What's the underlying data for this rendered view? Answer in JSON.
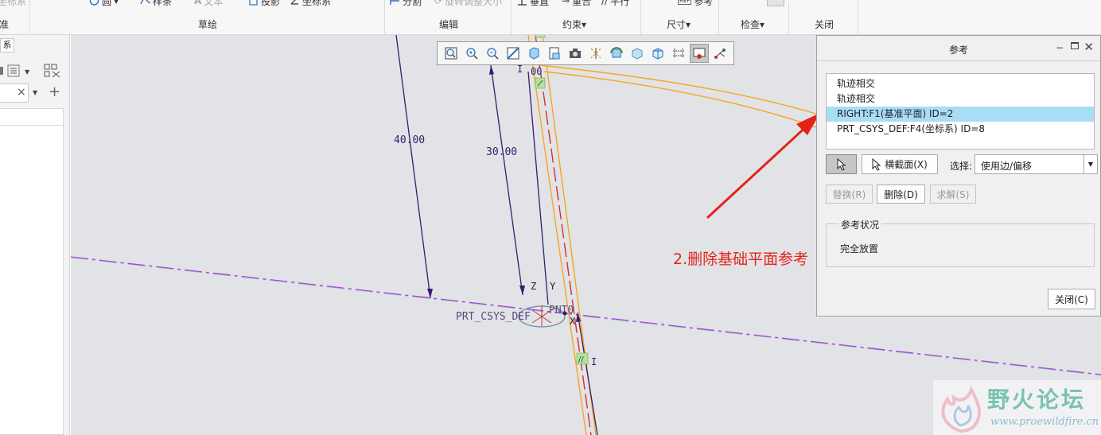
{
  "ribbon": {
    "top_commands": {
      "csys": "坐标系",
      "circle": "圆",
      "spline": "样条",
      "text": "文本",
      "project": "投影",
      "csys2": "坐标系",
      "divide": "分割",
      "rotate_resize": "旋转调整大小",
      "vertical": "垂直",
      "coincident": "重合",
      "parallel": "平行",
      "reference": "参考"
    },
    "groups": {
      "datum": "准",
      "sketch": "草绘",
      "edit": "编辑",
      "constrain": "约束▾",
      "dimension": "尺寸▾",
      "inspect": "检查▾",
      "close": "关闭"
    }
  },
  "left_panel": {
    "tab_char": "系"
  },
  "sketch": {
    "dim_40": "40.00",
    "dim_30": "30.00",
    "dim_00": "00",
    "csys_label": "PRT_CSYS_DEF",
    "point_label": "PNT0",
    "axis_z": "Z",
    "axis_y": "Y",
    "axis_x": "X",
    "marker_i": "I",
    "marker_parallel": "//",
    "marker_i2": "I"
  },
  "dialog": {
    "title": "参考",
    "references": [
      "轨迹相交",
      "轨迹相交",
      "RIGHT:F1(基准平面) ID=2",
      "PRT_CSYS_DEF:F4(坐标系) ID=8"
    ],
    "selected_index": 2,
    "section_button": "横截面(X)",
    "select_label": "选择:",
    "select_value": "使用边/偏移",
    "replace_button": "替换(R)",
    "delete_button": "删除(D)",
    "solve_button": "求解(S)",
    "status_title": "参考状况",
    "status_value": "完全放置",
    "close_button": "关闭(C)"
  },
  "annotation": {
    "text": "2.删除基础平面参考",
    "color": "#e2231a"
  },
  "watermark": {
    "title": "野火论坛",
    "url": "www.proewildfire.cn"
  },
  "colors": {
    "canvas_bg": "#e2e3e6",
    "dim_line": "#3b1a6e",
    "edge_orange": "#f5a623",
    "centerline": "#b43de0",
    "selection_blue": "#a9dcf5"
  }
}
